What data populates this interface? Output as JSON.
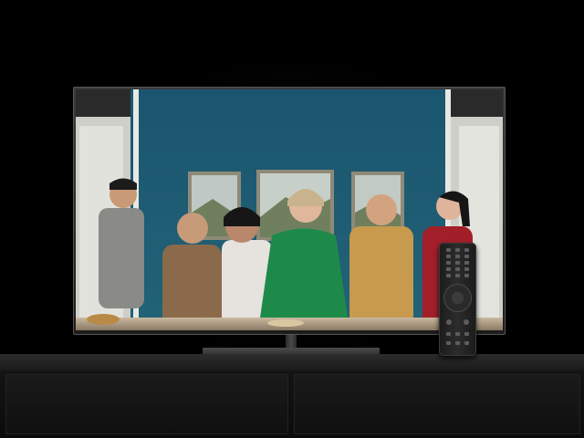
{
  "scene": {
    "description_free": true,
    "colors": {
      "background": "#000000",
      "screen_wall": "#1f5d72",
      "cabinet": "#1a1a1a"
    },
    "icons": [
      "tv-remote-icon",
      "dpad-icon"
    ]
  }
}
